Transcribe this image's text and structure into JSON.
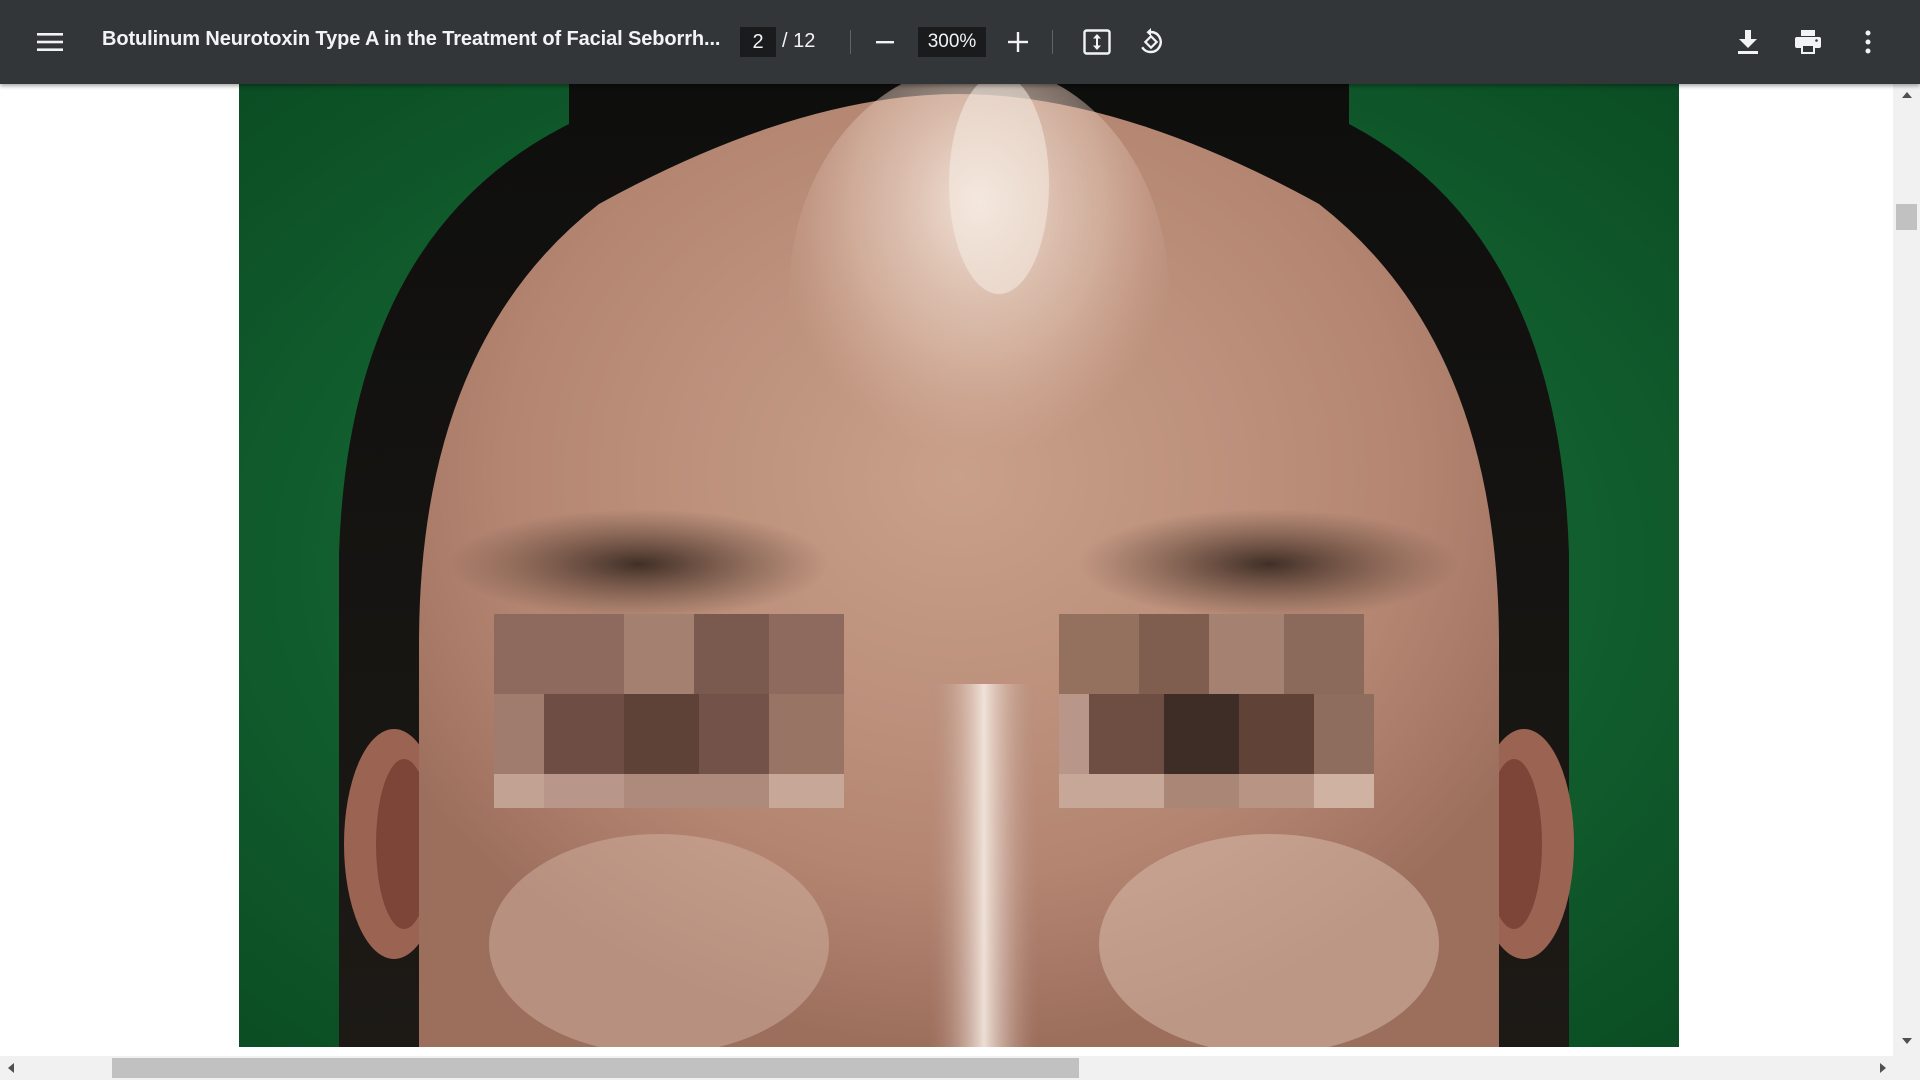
{
  "toolbar": {
    "menu_icon": "hamburger-menu-icon",
    "title": "Botulinum Neurotoxin Type A in the Treatment of Facial Seborrh...",
    "page_current": "2",
    "page_separator": "/ 12",
    "zoom_out_icon": "minus-icon",
    "zoom_value": "300%",
    "zoom_in_icon": "plus-icon",
    "fit_icon": "fit-to-page-icon",
    "rotate_icon": "rotate-counterclockwise-icon",
    "download_icon": "download-icon",
    "print_icon": "print-icon",
    "more_icon": "more-vertical-icon"
  },
  "colors": {
    "toolbar_bg": "#323639",
    "toolbar_text": "#f1f3f4",
    "input_bg": "#191b1c",
    "photo_background_green": "#0f5a2c",
    "scrollbar_track": "#f1f1f1",
    "scrollbar_thumb": "#c1c1c1"
  }
}
